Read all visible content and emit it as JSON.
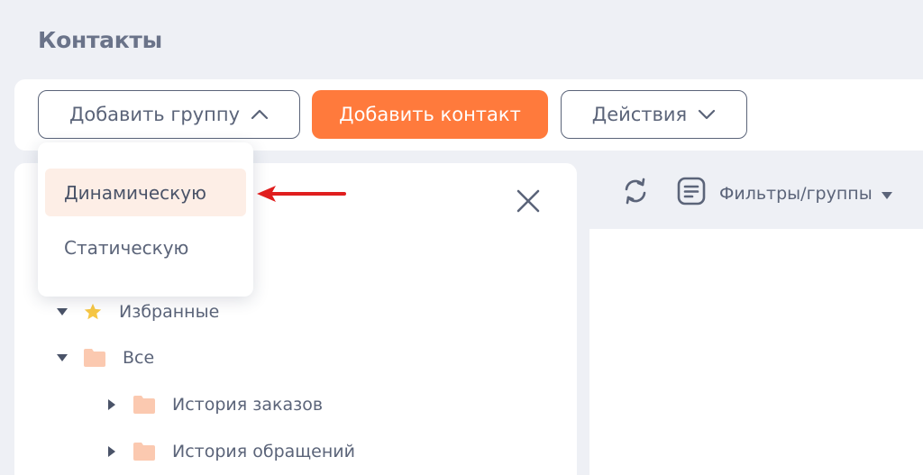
{
  "page": {
    "title": "Контакты"
  },
  "toolbar": {
    "add_group_label": "Добавить группу",
    "add_contact_label": "Добавить контакт",
    "actions_label": "Действия"
  },
  "dropdown": {
    "items": [
      {
        "label": "Динамическую",
        "active": true
      },
      {
        "label": "Статическую",
        "active": false
      }
    ]
  },
  "tree": {
    "items": [
      {
        "label": "Избранные",
        "icon": "star-icon",
        "expanded": true
      },
      {
        "label": "Все",
        "icon": "folder-icon",
        "expanded": true
      },
      {
        "label": "История заказов",
        "icon": "folder-icon",
        "expanded": false
      },
      {
        "label": "История обращений",
        "icon": "folder-icon",
        "expanded": false
      }
    ]
  },
  "right_header": {
    "filter_label": "Фильтры/группы"
  },
  "icons": {
    "close": "close-icon",
    "refresh": "refresh-icon",
    "filter": "document-list-icon",
    "chevron_up": "chevron-up-icon",
    "chevron_down": "chevron-down-icon",
    "annotation_arrow": "red-arrow-icon"
  },
  "colors": {
    "accent": "#ff7a3c",
    "text": "#5b6479",
    "background": "#eef0f5",
    "active_item_bg": "#fdeee6",
    "folder": "#fbc9b0",
    "star": "#f7c744",
    "arrow": "#e01e1e"
  }
}
